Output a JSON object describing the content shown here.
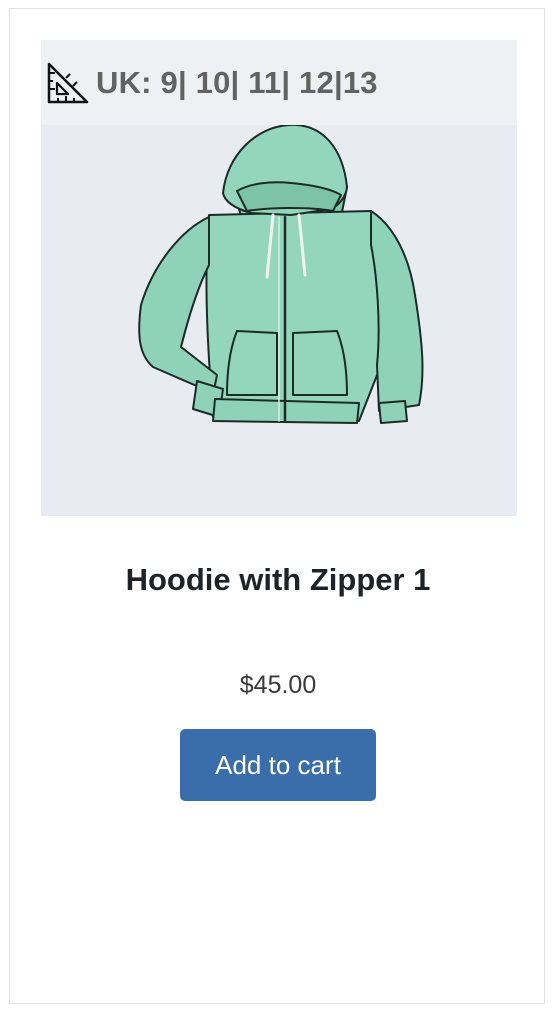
{
  "product": {
    "size_label": "UK: 9| 10| 11| 12|13",
    "size_icon": "ruler-triangle-icon",
    "image": "hoodie-illustration",
    "title": "Hoodie with Zipper 1",
    "price": "$45.00",
    "add_to_cart_label": "Add to cart"
  },
  "colors": {
    "button": "#3a6eab",
    "hoodie": "#94d5be",
    "image_background": "#e8ebf0"
  }
}
